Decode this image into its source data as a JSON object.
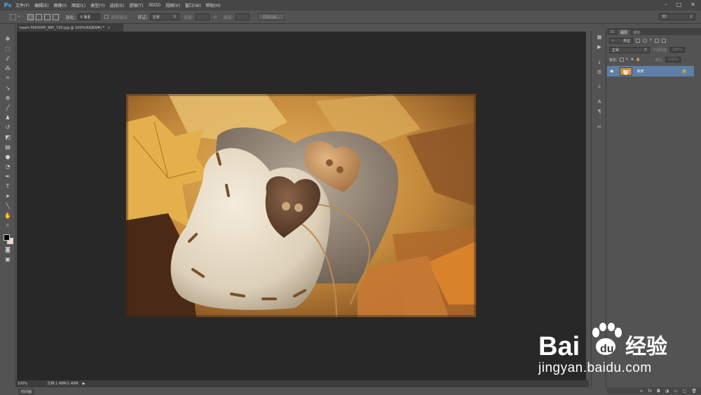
{
  "app": {
    "logo": "Ps"
  },
  "menubar": {
    "items": [
      "文件(F)",
      "编辑(E)",
      "图像(I)",
      "图层(L)",
      "类型(Y)",
      "选择(S)",
      "滤镜(T)",
      "3D(D)",
      "视图(V)",
      "窗口(W)",
      "帮助(H)"
    ]
  },
  "options": {
    "feather_label": "羽化:",
    "feather_value": "0 像素",
    "antialias_label": "消除锯齿",
    "style_label": "样式:",
    "style_value": "正常",
    "width_label": "宽度:",
    "height_label": "高度:",
    "refine_button": "调整边缘...",
    "workspace_value": "3D"
  },
  "document": {
    "tab_title": "heart-3063045_960_720.jpg @ 100%(RGB/8#) *",
    "close_glyph": "×"
  },
  "status": {
    "zoom": "100%",
    "doc_info": "文档:1.48M/1.48M",
    "timeline_label": "时间轴"
  },
  "layers_panel": {
    "tabs": [
      "3D",
      "图层",
      "通道"
    ],
    "active_tab": "图层",
    "filter_label": "类型",
    "blend_mode": "正常",
    "opacity_label": "不透明度:",
    "opacity_value": "100%",
    "lock_label": "锁定:",
    "fill_label": "填充:",
    "fill_value": "100%",
    "layer_name": "背景"
  },
  "watermark": {
    "brand": "Bai",
    "brand_suffix": "经验",
    "url": "jingyan.baidu.com"
  },
  "colors": {
    "foreground": "#000000",
    "background": "#f6d2d2",
    "selected_layer": "#5e7fa8",
    "canvas_bg": "#282828"
  }
}
